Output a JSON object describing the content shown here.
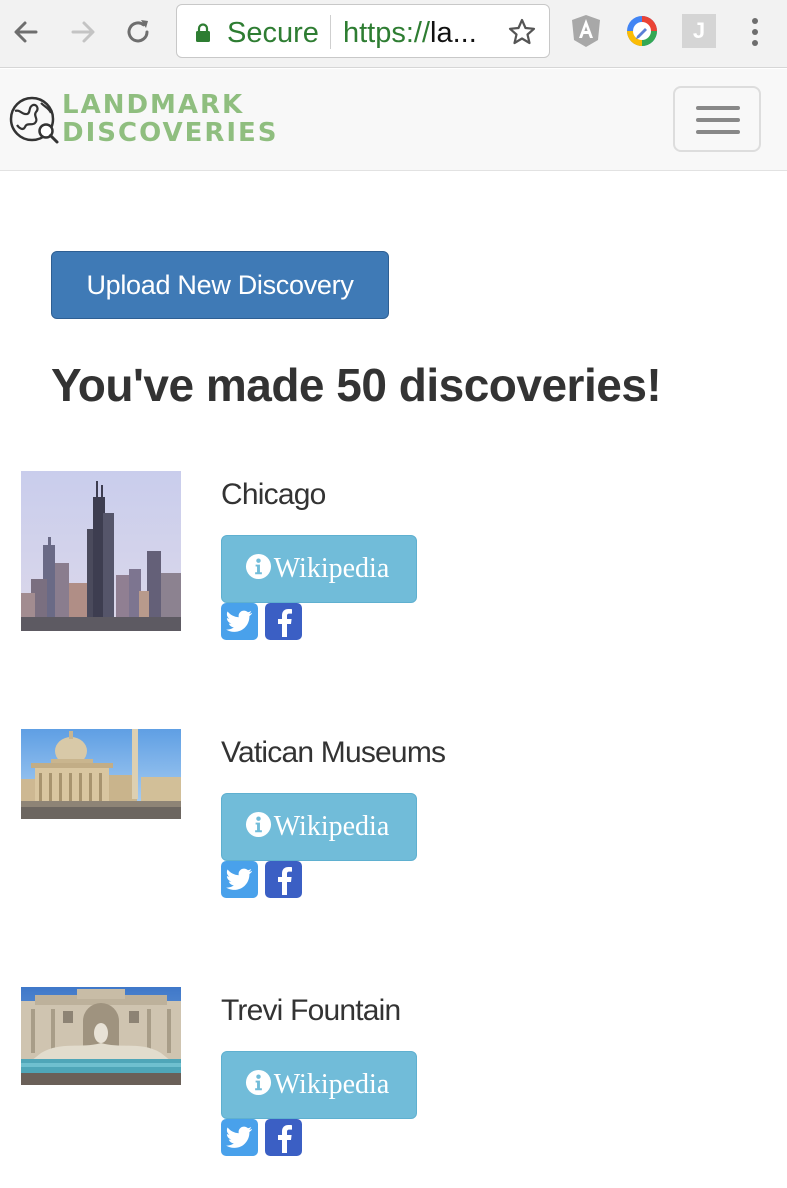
{
  "browser": {
    "security_label": "Secure",
    "url_scheme": "https://",
    "url_host": "la...",
    "extensions": [
      {
        "name": "angular-extension-icon"
      },
      {
        "name": "color-picker-extension-icon"
      },
      {
        "name": "j-extension",
        "label": "J"
      }
    ]
  },
  "site": {
    "logo_line1": "LANDMARK",
    "logo_line2": "DISCOVERIES",
    "brand_color": "#8fbe7f"
  },
  "main": {
    "upload_button": "Upload New Discovery",
    "headline": "You've made 50 discoveries!",
    "discoveries": [
      {
        "title": "Chicago",
        "wiki_label": "Wikipedia",
        "image": "chicago-skyline-photo"
      },
      {
        "title": "Vatican Museums",
        "wiki_label": "Wikipedia",
        "image": "st-peters-basilica-photo"
      },
      {
        "title": "Trevi Fountain",
        "wiki_label": "Wikipedia",
        "image": "trevi-fountain-photo"
      }
    ]
  },
  "colors": {
    "primary_button": "#3f7ab6",
    "info_button": "#71bcd9",
    "twitter": "#49a1eb",
    "facebook": "#3b5fc4",
    "secure_green": "#2e7d32"
  }
}
